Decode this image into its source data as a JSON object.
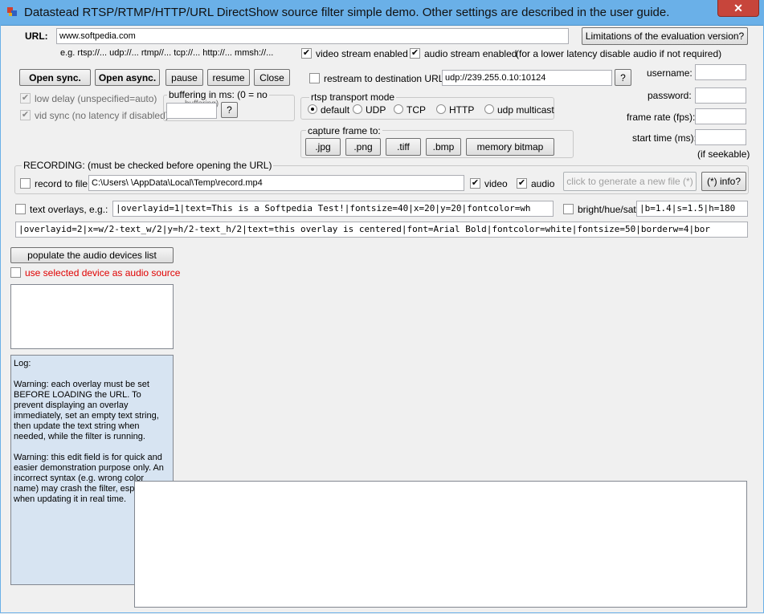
{
  "window": {
    "title": "Datastead RTSP/RTMP/HTTP/URL DirectShow source filter simple demo. Other settings are described in the user guide.",
    "close_glyph": "✕"
  },
  "url": {
    "label": "URL:",
    "value": "www.softpedia.com",
    "examples": "e.g. rtsp://...  udp://...  rtmp//...  tcp://...  http://...   mmsh://...",
    "limitations_button": "Limitations of the evaluation version?"
  },
  "streams": {
    "video_label": "video stream enabled",
    "video_checked": true,
    "audio_label": "audio stream enabled",
    "audio_checked": true,
    "note": "(for a lower latency disable audio if not required)"
  },
  "toolbar": {
    "open_sync": "Open sync.",
    "open_async": "Open async.",
    "pause": "pause",
    "resume": "resume",
    "close": "Close"
  },
  "restream": {
    "label": "restream to destination URL:",
    "checked": false,
    "value": "udp://239.255.0.10:10124",
    "help": "?"
  },
  "credentials": {
    "username_label": "username:",
    "password_label": "password:",
    "framerate_label": "frame rate (fps):",
    "starttime_label": "start time (ms):",
    "seekable_note": "(if seekable)"
  },
  "options": {
    "low_delay": "low delay (unspecified=auto)",
    "vid_sync": "vid sync (no latency if disabled)",
    "buffering_title": "buffering in ms: (0 = no",
    "buffering_sub": "buffering)",
    "buffering_help": "?"
  },
  "transport": {
    "title": "rtsp transport mode",
    "options": [
      "default",
      "UDP",
      "TCP",
      "HTTP",
      "udp multicast"
    ],
    "selected": "default"
  },
  "capture": {
    "title": "capture frame to:",
    "buttons": [
      ".jpg",
      ".png",
      ".tiff",
      ".bmp",
      "memory bitmap"
    ]
  },
  "recording": {
    "title": "RECORDING: (must be checked before opening the URL)",
    "record_label": "record to file:",
    "file_path": "C:\\Users\\            \\AppData\\Local\\Temp\\record.mp4",
    "video_label": "video",
    "audio_label": "audio",
    "generate_button": "click to generate a new file (*)",
    "info_button": "(*) info?"
  },
  "overlays": {
    "label": "text overlays, e.g.:",
    "overlay1": "|overlayid=1|text=This is a Softpedia Test!|fontsize=40|x=20|y=20|fontcolor=wh",
    "bright_label": "bright/hue/sat:",
    "bright_value": "|b=1.4|s=1.5|h=180",
    "overlay2": "|overlayid=2|x=w/2-text_w/2|y=h/2-text_h/2|text=this overlay is centered|font=Arial Bold|fontcolor=white|fontsize=50|borderw=4|bor"
  },
  "audio_devices": {
    "populate_button": "populate the audio devices list",
    "use_selected": "use selected device as audio source"
  },
  "log": {
    "title": "Log:",
    "warning1": "Warning: each overlay must be set BEFORE LOADING the URL. To prevent displaying an overlay immediately, set an empty text string, then update the text string when needed, while the filter is running.",
    "warning2": "Warning: this edit field is for quick and easier demonstration purpose only. An incorrect syntax (e.g. wrong color name) may crash the filter, especially when updating it in real time."
  },
  "colors": {
    "titlebar": "#6ab0e8",
    "close": "#c7453b",
    "log_bg": "#d7e4f2",
    "warning_red": "#e00000"
  }
}
